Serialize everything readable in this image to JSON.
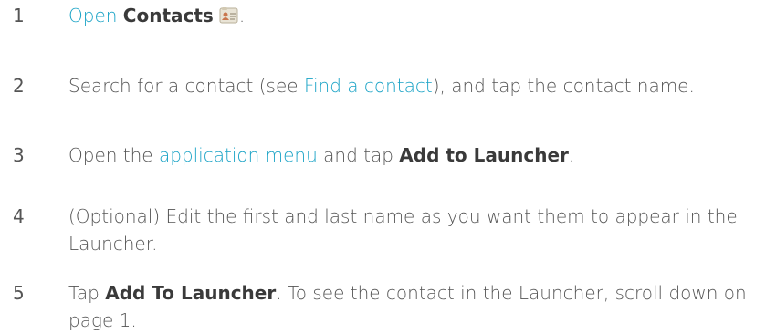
{
  "steps": [
    {
      "number": "1",
      "link": "Open",
      "bold": "Contacts",
      "end": ".",
      "icon": "contacts-app-icon"
    },
    {
      "number": "2",
      "before": "Search for a contact (see ",
      "link": "Find a contact",
      "after": "), and tap the contact name."
    },
    {
      "number": "3",
      "before": "Open the ",
      "link": "application menu",
      "middle": " and tap ",
      "bold": "Add to Launcher",
      "end": "."
    },
    {
      "number": "4",
      "text": "(Optional) Edit the first and last name as you want them to appear in the Launcher."
    },
    {
      "number": "5",
      "before": "Tap ",
      "bold": "Add To Launcher",
      "after": ". To see the contact in the Launcher, scroll down on page 1."
    }
  ]
}
